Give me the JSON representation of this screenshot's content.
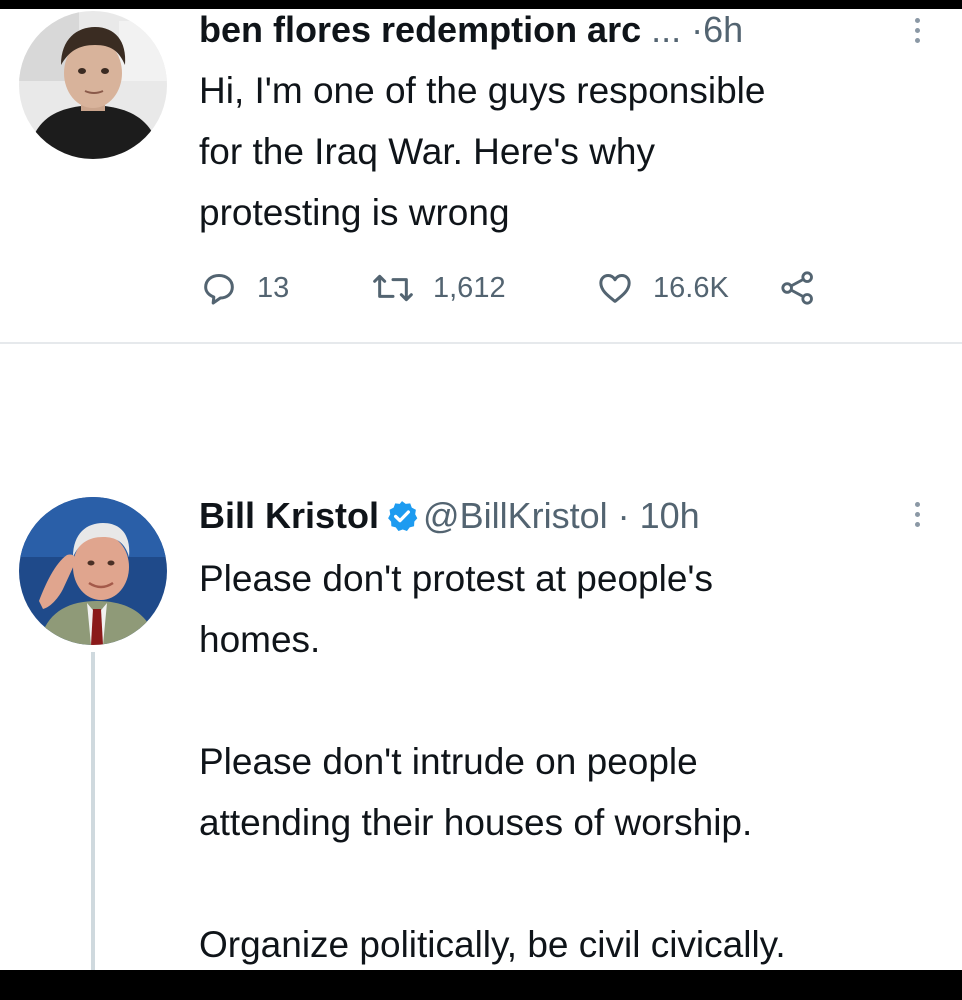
{
  "tweets": [
    {
      "display_name": "ben flores redemption arc",
      "name_truncation": "...",
      "separator": "·",
      "time": "6h",
      "text_lines": [
        "Hi, I'm one of the guys responsible",
        "for the Iraq War. Here's why",
        "protesting is wrong"
      ],
      "actions": {
        "reply_count": "13",
        "retweet_count": "1,612",
        "like_count": "16.6K"
      }
    },
    {
      "display_name": "Bill Kristol",
      "verified": true,
      "handle": "@BillKristol",
      "separator": "·",
      "time": "10h",
      "paragraphs": [
        [
          "Please don't protest at people's",
          "homes."
        ],
        [
          "Please don't intrude on people",
          "attending their houses of worship."
        ],
        [
          "Organize politically, be civil civically."
        ]
      ]
    }
  ],
  "colors": {
    "text_primary": "#0f1419",
    "text_secondary": "#536471",
    "verified_blue": "#1d9bf0",
    "divider": "#e6e9ec"
  },
  "icons": [
    "reply-icon",
    "retweet-icon",
    "like-icon",
    "share-icon",
    "verified-icon",
    "more-icon"
  ]
}
